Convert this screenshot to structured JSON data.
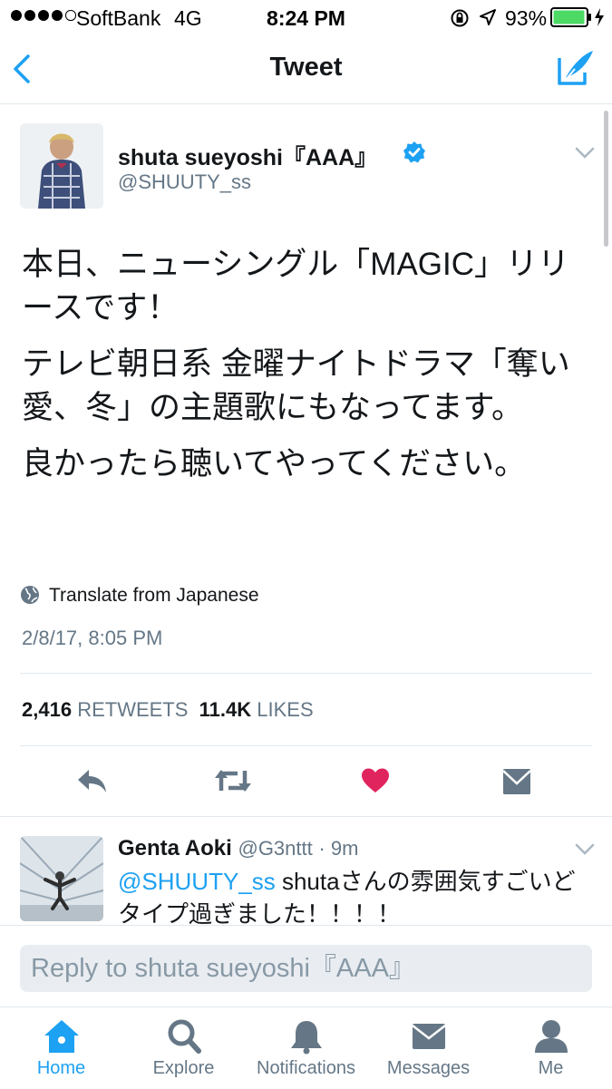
{
  "status_bar": {
    "carrier": "SoftBank",
    "network": "4G",
    "time": "8:24 PM",
    "battery": "93%",
    "signal_bars": 4
  },
  "nav": {
    "title": "Tweet",
    "back_icon": "chevron-left-icon",
    "compose_icon": "compose-icon"
  },
  "tweet": {
    "author_name": "shuta  sueyoshi『AAA』",
    "handle": "@SHUUTY_ss",
    "paragraphs": [
      "本日、ニューシングル「MAGIC」リリースです！",
      "テレビ朝日系 金曜ナイトドラマ「奪い愛、冬」の主題歌にもなってます。",
      "良かったら聴いてやってください。"
    ],
    "translate_label": "Translate from Japanese",
    "timestamp": "2/8/17, 8:05 PM",
    "retweets_count": "2,416",
    "retweets_label": "RETWEETS",
    "likes_count": "11.4K",
    "likes_label": "LIKES"
  },
  "reply_item": {
    "author_name": "Genta Aoki",
    "handle": "@G3nttt",
    "time": "· 9m",
    "mention": "@SHUUTY_ss",
    "text": " shutaさんの雰囲気すごいどタイプ過ぎました！！！！"
  },
  "reply_input": {
    "placeholder": "Reply to shuta  sueyoshi『AAA』"
  },
  "tabs": [
    {
      "label": "Home",
      "icon": "home-icon"
    },
    {
      "label": "Explore",
      "icon": "search-icon"
    },
    {
      "label": "Notifications",
      "icon": "bell-icon"
    },
    {
      "label": "Messages",
      "icon": "envelope-icon"
    },
    {
      "label": "Me",
      "icon": "person-icon"
    }
  ],
  "colors": {
    "accent": "#1da1f2",
    "like": "#e0245e",
    "secondary_text": "#657786",
    "battery": "#4cd964"
  }
}
